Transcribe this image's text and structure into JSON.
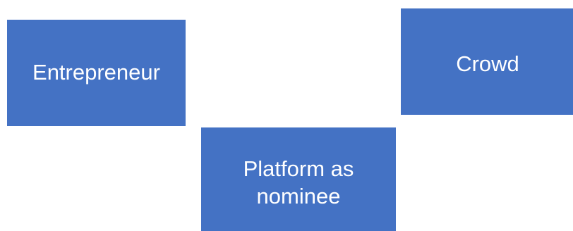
{
  "colors": {
    "box_fill": "#4472C4",
    "text": "#FFFFFF",
    "background": "#FFFFFF"
  },
  "nodes": {
    "entrepreneur": {
      "label": "Entrepreneur"
    },
    "crowd": {
      "label": "Crowd"
    },
    "platform": {
      "label": "Platform as\nnominee"
    }
  }
}
